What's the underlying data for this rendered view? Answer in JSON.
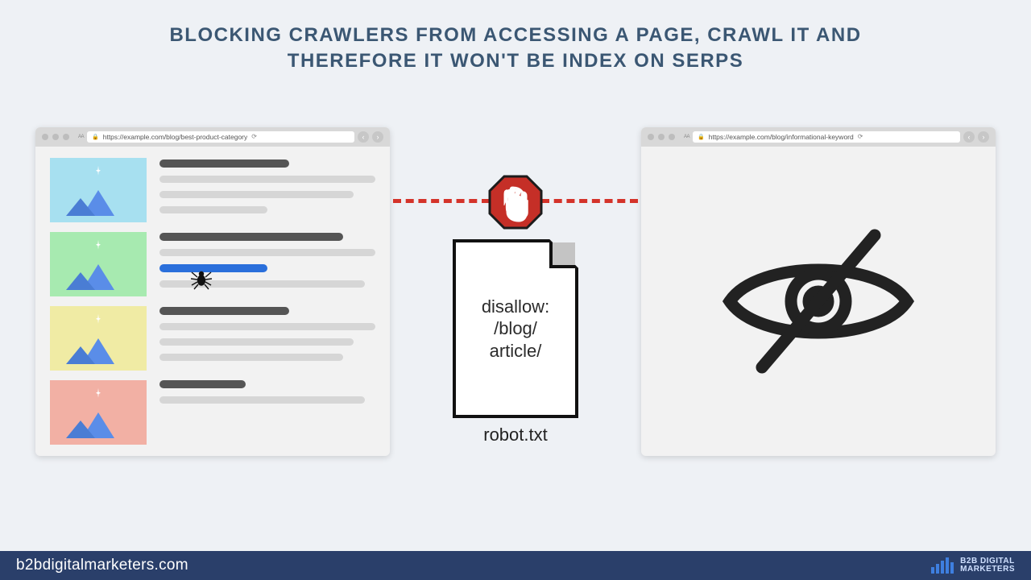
{
  "title_line1": "BLOCKING CRAWLERS FROM ACCESSING A PAGE, CRAWL IT AND",
  "title_line2": "THEREFORE IT WON'T BE INDEX ON SERPS",
  "browser_left": {
    "url": "https://example.com/blog/best-product-category"
  },
  "browser_right": {
    "url": "https://example.com/blog/informational-keyword"
  },
  "file": {
    "line1": "disallow:",
    "line2": "/blog/",
    "line3": "article/",
    "label": "robot.txt"
  },
  "footer": {
    "site": "b2bdigitalmarketers.com",
    "brand_line1": "B2B DIGITAL",
    "brand_line2": "MARKETERS"
  }
}
